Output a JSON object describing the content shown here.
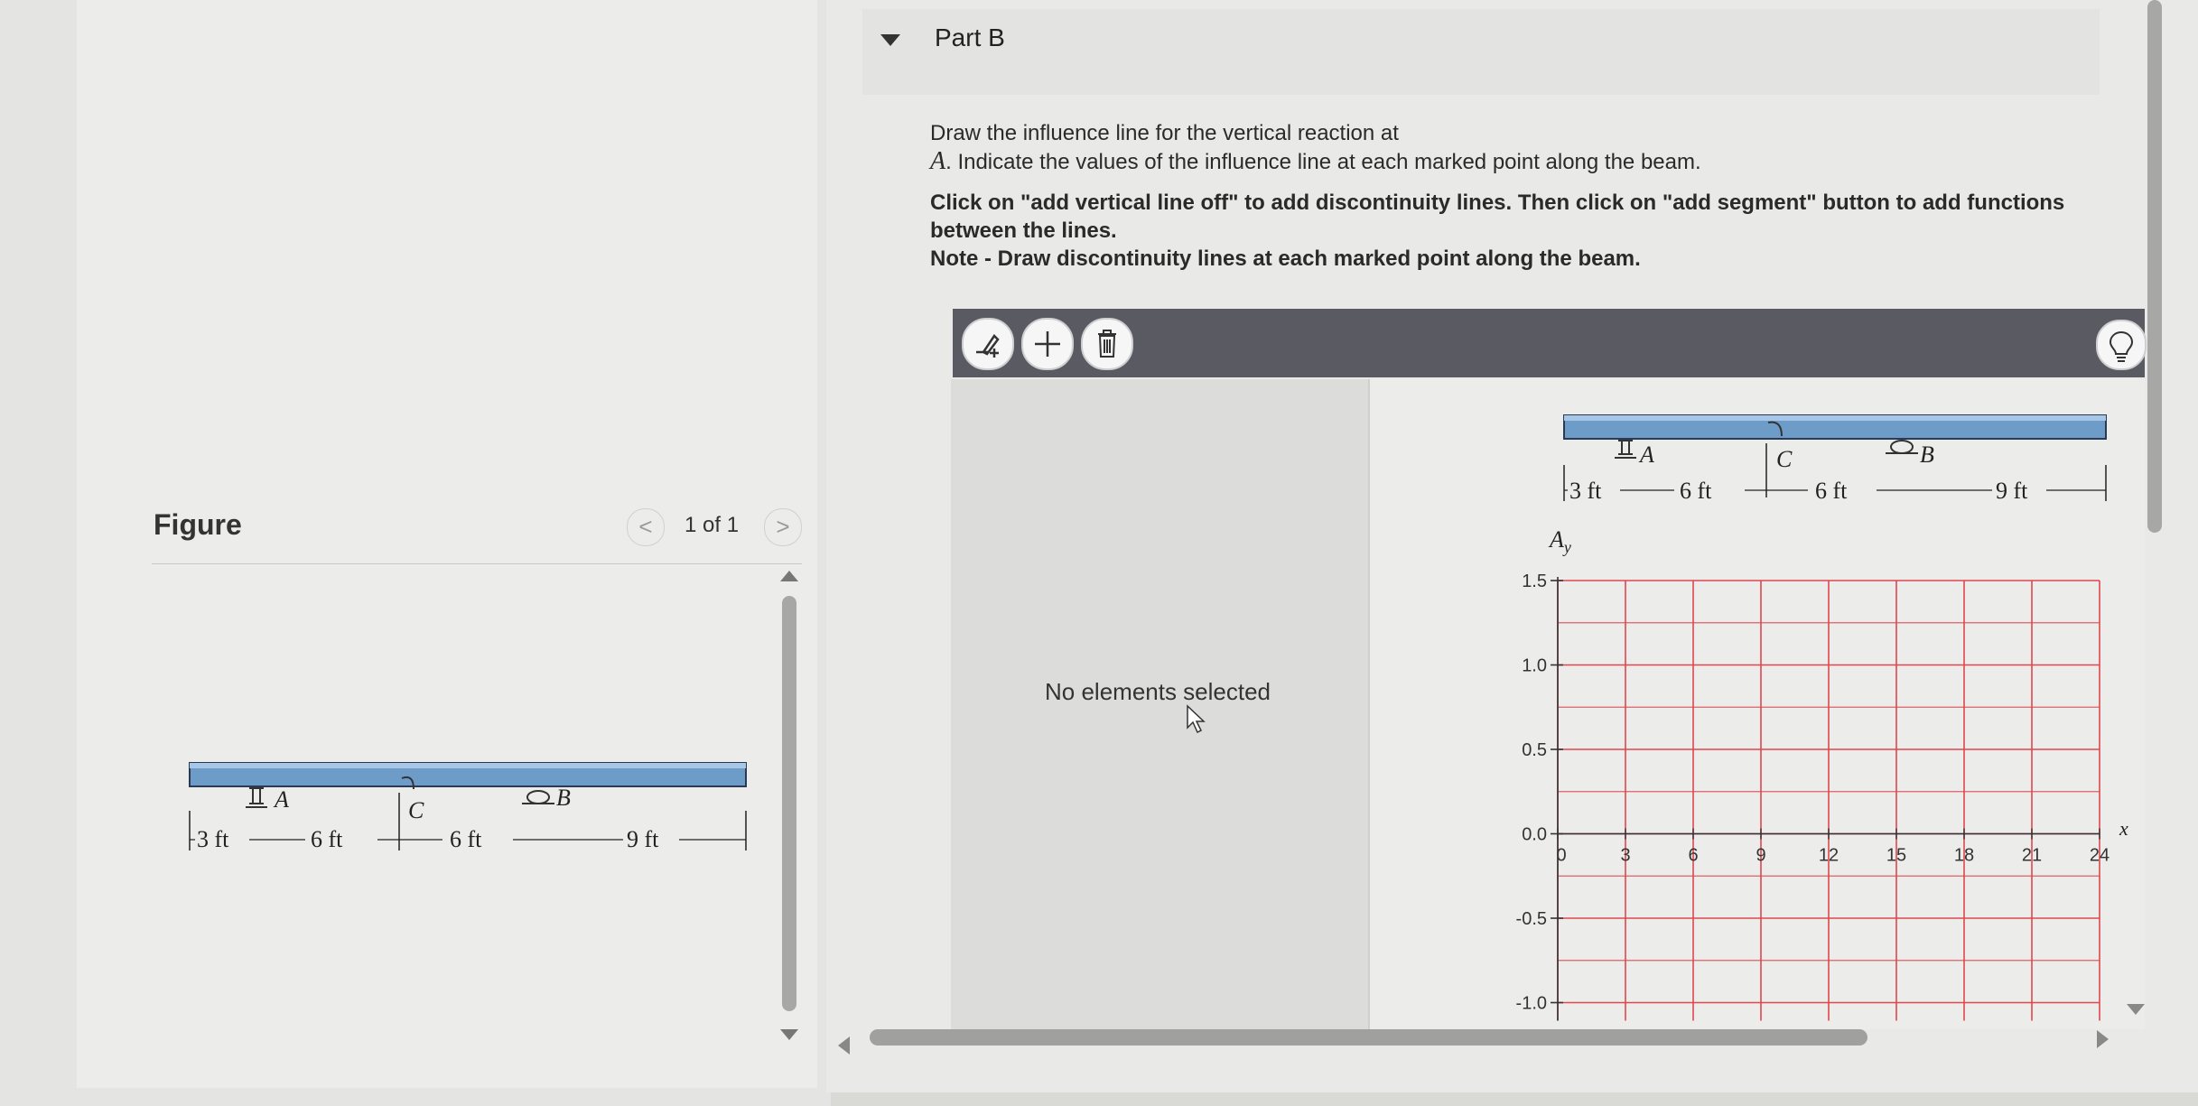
{
  "part": {
    "title": "Part B"
  },
  "prompt": {
    "line1": "Draw the influence line for the vertical reaction at",
    "reaction_symbol": "A",
    "line2": ". Indicate the values of the influence line at each marked point along the beam.",
    "instruction1": "Click on \"add vertical line off\" to add discontinuity lines. Then click on \"add segment\" button to add functions between the lines.",
    "instruction2": "Note - Draw discontinuity lines at each marked point along the beam."
  },
  "figure": {
    "title": "Figure",
    "page": "1 of 1",
    "prev": "<",
    "next": ">"
  },
  "beam": {
    "support_a": "A",
    "hinge_c": "C",
    "support_b": "B",
    "dims": [
      "3 ft",
      "6 ft",
      "6 ft",
      "9 ft"
    ]
  },
  "toolbar": {
    "tools": [
      "add-vertical-line-icon",
      "add-segment-icon",
      "trash-icon"
    ],
    "hint": "lightbulb-icon"
  },
  "properties": {
    "empty_text": "No elements selected"
  },
  "graph": {
    "y_label_main": "A",
    "y_label_sub": "y",
    "x_label": "x",
    "y_ticks": [
      "1.5",
      "1.0",
      "0.5",
      "0.0",
      "-0.5",
      "-1.0"
    ],
    "x_ticks": [
      "0",
      "3",
      "6",
      "9",
      "12",
      "15",
      "18",
      "21",
      "24"
    ],
    "grid_color": "#e0474f"
  }
}
